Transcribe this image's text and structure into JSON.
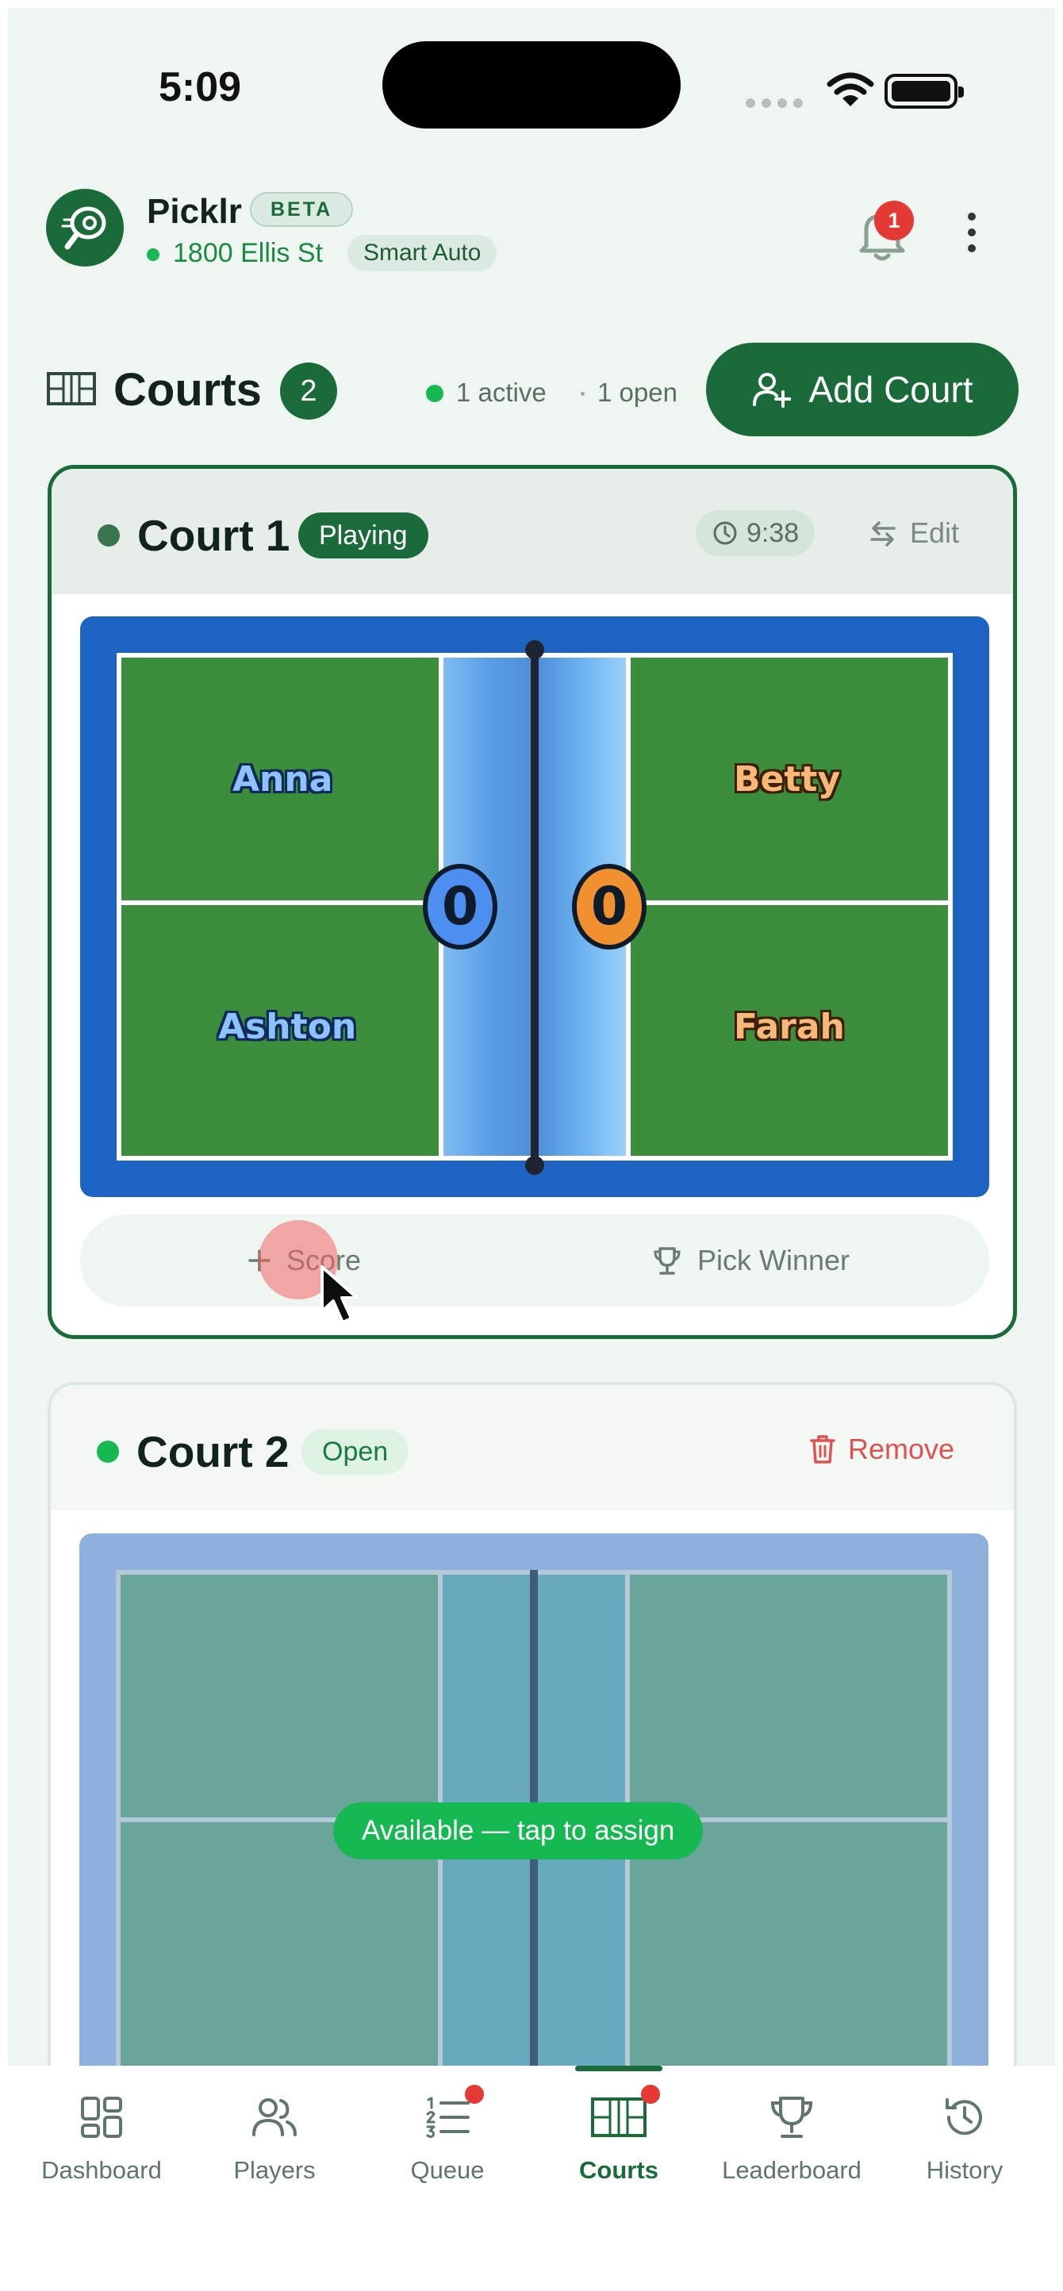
{
  "status_bar": {
    "time": "5:09"
  },
  "app": {
    "name": "Picklr",
    "beta_label": "BETA",
    "location": "1800 Ellis St",
    "mode_label": "Smart Auto",
    "notification_count": "1"
  },
  "courts_header": {
    "title": "Courts",
    "count": "2",
    "active_text": "1 active",
    "open_text": "1 open",
    "add_button_label": "Add Court"
  },
  "courts": [
    {
      "name": "Court 1",
      "status": "Playing",
      "timer": "9:38",
      "edit_label": "Edit",
      "team_left": {
        "players": [
          "Anna",
          "Ashton"
        ],
        "score": "0"
      },
      "team_right": {
        "players": [
          "Betty",
          "Farah"
        ],
        "score": "0"
      },
      "score_button_label": "Score",
      "pick_winner_label": "Pick Winner"
    },
    {
      "name": "Court 2",
      "status": "Open",
      "remove_label": "Remove",
      "assign_prompt": "Available — tap to assign"
    }
  ],
  "colors": {
    "brand_green": "#1b6b3a",
    "status_green": "#16b851",
    "court_surface": "#3b8f3c",
    "court_border": "#1c63c4",
    "danger": "#e05252",
    "team_left": "#4d8ff0",
    "team_right": "#f0902f"
  },
  "bottom_nav": {
    "items": [
      {
        "label": "Dashboard",
        "icon": "dashboard-icon"
      },
      {
        "label": "Players",
        "icon": "players-icon"
      },
      {
        "label": "Queue",
        "icon": "queue-icon"
      },
      {
        "label": "Courts",
        "icon": "courts-icon"
      },
      {
        "label": "Leaderboard",
        "icon": "trophy-icon"
      },
      {
        "label": "History",
        "icon": "history-icon"
      }
    ],
    "active": "Courts"
  }
}
